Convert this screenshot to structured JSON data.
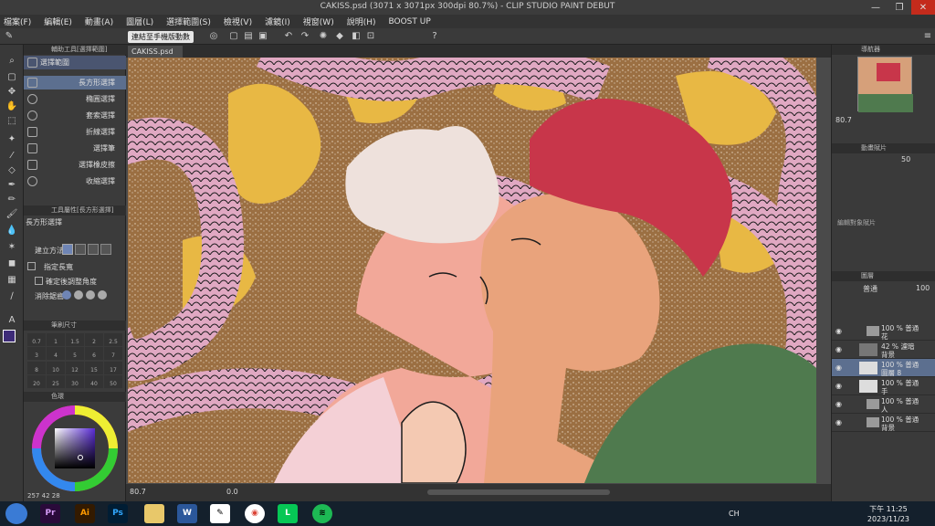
{
  "window": {
    "title": "CAKISS.psd (3071 x 3071px 300dpi 80.7%) - CLIP STUDIO PAINT DEBUT"
  },
  "menu": [
    "檔案(F)",
    "編輯(E)",
    "動畫(A)",
    "圖層(L)",
    "選擇範圍(S)",
    "檢視(V)",
    "濾鏡(I)",
    "視窗(W)",
    "說明(H)",
    "BOOST UP"
  ],
  "toolbar": {
    "snap_button": "連結至手機版動數"
  },
  "sub_tool": {
    "header": "輔助工具[選擇範圍]",
    "group": "選擇範圍",
    "items": [
      "長方形選擇",
      "橢圓選擇",
      "套索選擇",
      "折線選擇",
      "選擇筆",
      "選擇橡皮擦",
      "收縮選擇"
    ]
  },
  "tool_property": {
    "header": "工具屬性[長方形選擇]",
    "name": "長方形選擇",
    "create_method": "建立方法",
    "aspect": "指定長寬",
    "adjust_angle": "確定後調整角度",
    "antialias": "消除鋸齒"
  },
  "brush_size": {
    "header": "筆刷尺寸",
    "sizes": [
      "0.7",
      "1",
      "1.5",
      "2",
      "2.5",
      "3",
      "4",
      "5",
      "6",
      "7",
      "8",
      "10",
      "12",
      "15",
      "17",
      "20",
      "25",
      "30",
      "40",
      "50"
    ]
  },
  "color": {
    "header": "色環",
    "readout": [
      "257",
      "42",
      "28"
    ]
  },
  "canvas": {
    "tab": "CAKISS.psd",
    "zoom": "80.7",
    "angle": "0.0"
  },
  "navigator": {
    "header": "導航器",
    "zoom": "80.7"
  },
  "animation": {
    "header": "動畫賦片",
    "value": "50",
    "message": "編輯對象賦片"
  },
  "layers": {
    "header": "圖層",
    "blend": "普通",
    "opacity": "100",
    "items": [
      {
        "line1": "100 % 普通",
        "line2": "花",
        "kind": "folder"
      },
      {
        "line1": "42 % 濾暗",
        "line2": "背景",
        "kind": "layer"
      },
      {
        "line1": "100 % 普通",
        "line2": "圖層 8",
        "kind": "layer",
        "selected": true
      },
      {
        "line1": "100 % 普通",
        "line2": "手",
        "kind": "layer"
      },
      {
        "line1": "100 % 普通",
        "line2": "人",
        "kind": "folder"
      },
      {
        "line1": "100 % 普通",
        "line2": "背景",
        "kind": "folder"
      }
    ]
  },
  "taskbar": {
    "apps": [
      "Pr",
      "Ai",
      "Ps"
    ],
    "ime": "CH",
    "time": "下午 11:25",
    "date": "2023/11/23"
  },
  "colors": {
    "accent": "#5c6f8f",
    "bg": "#2b2b2b"
  }
}
